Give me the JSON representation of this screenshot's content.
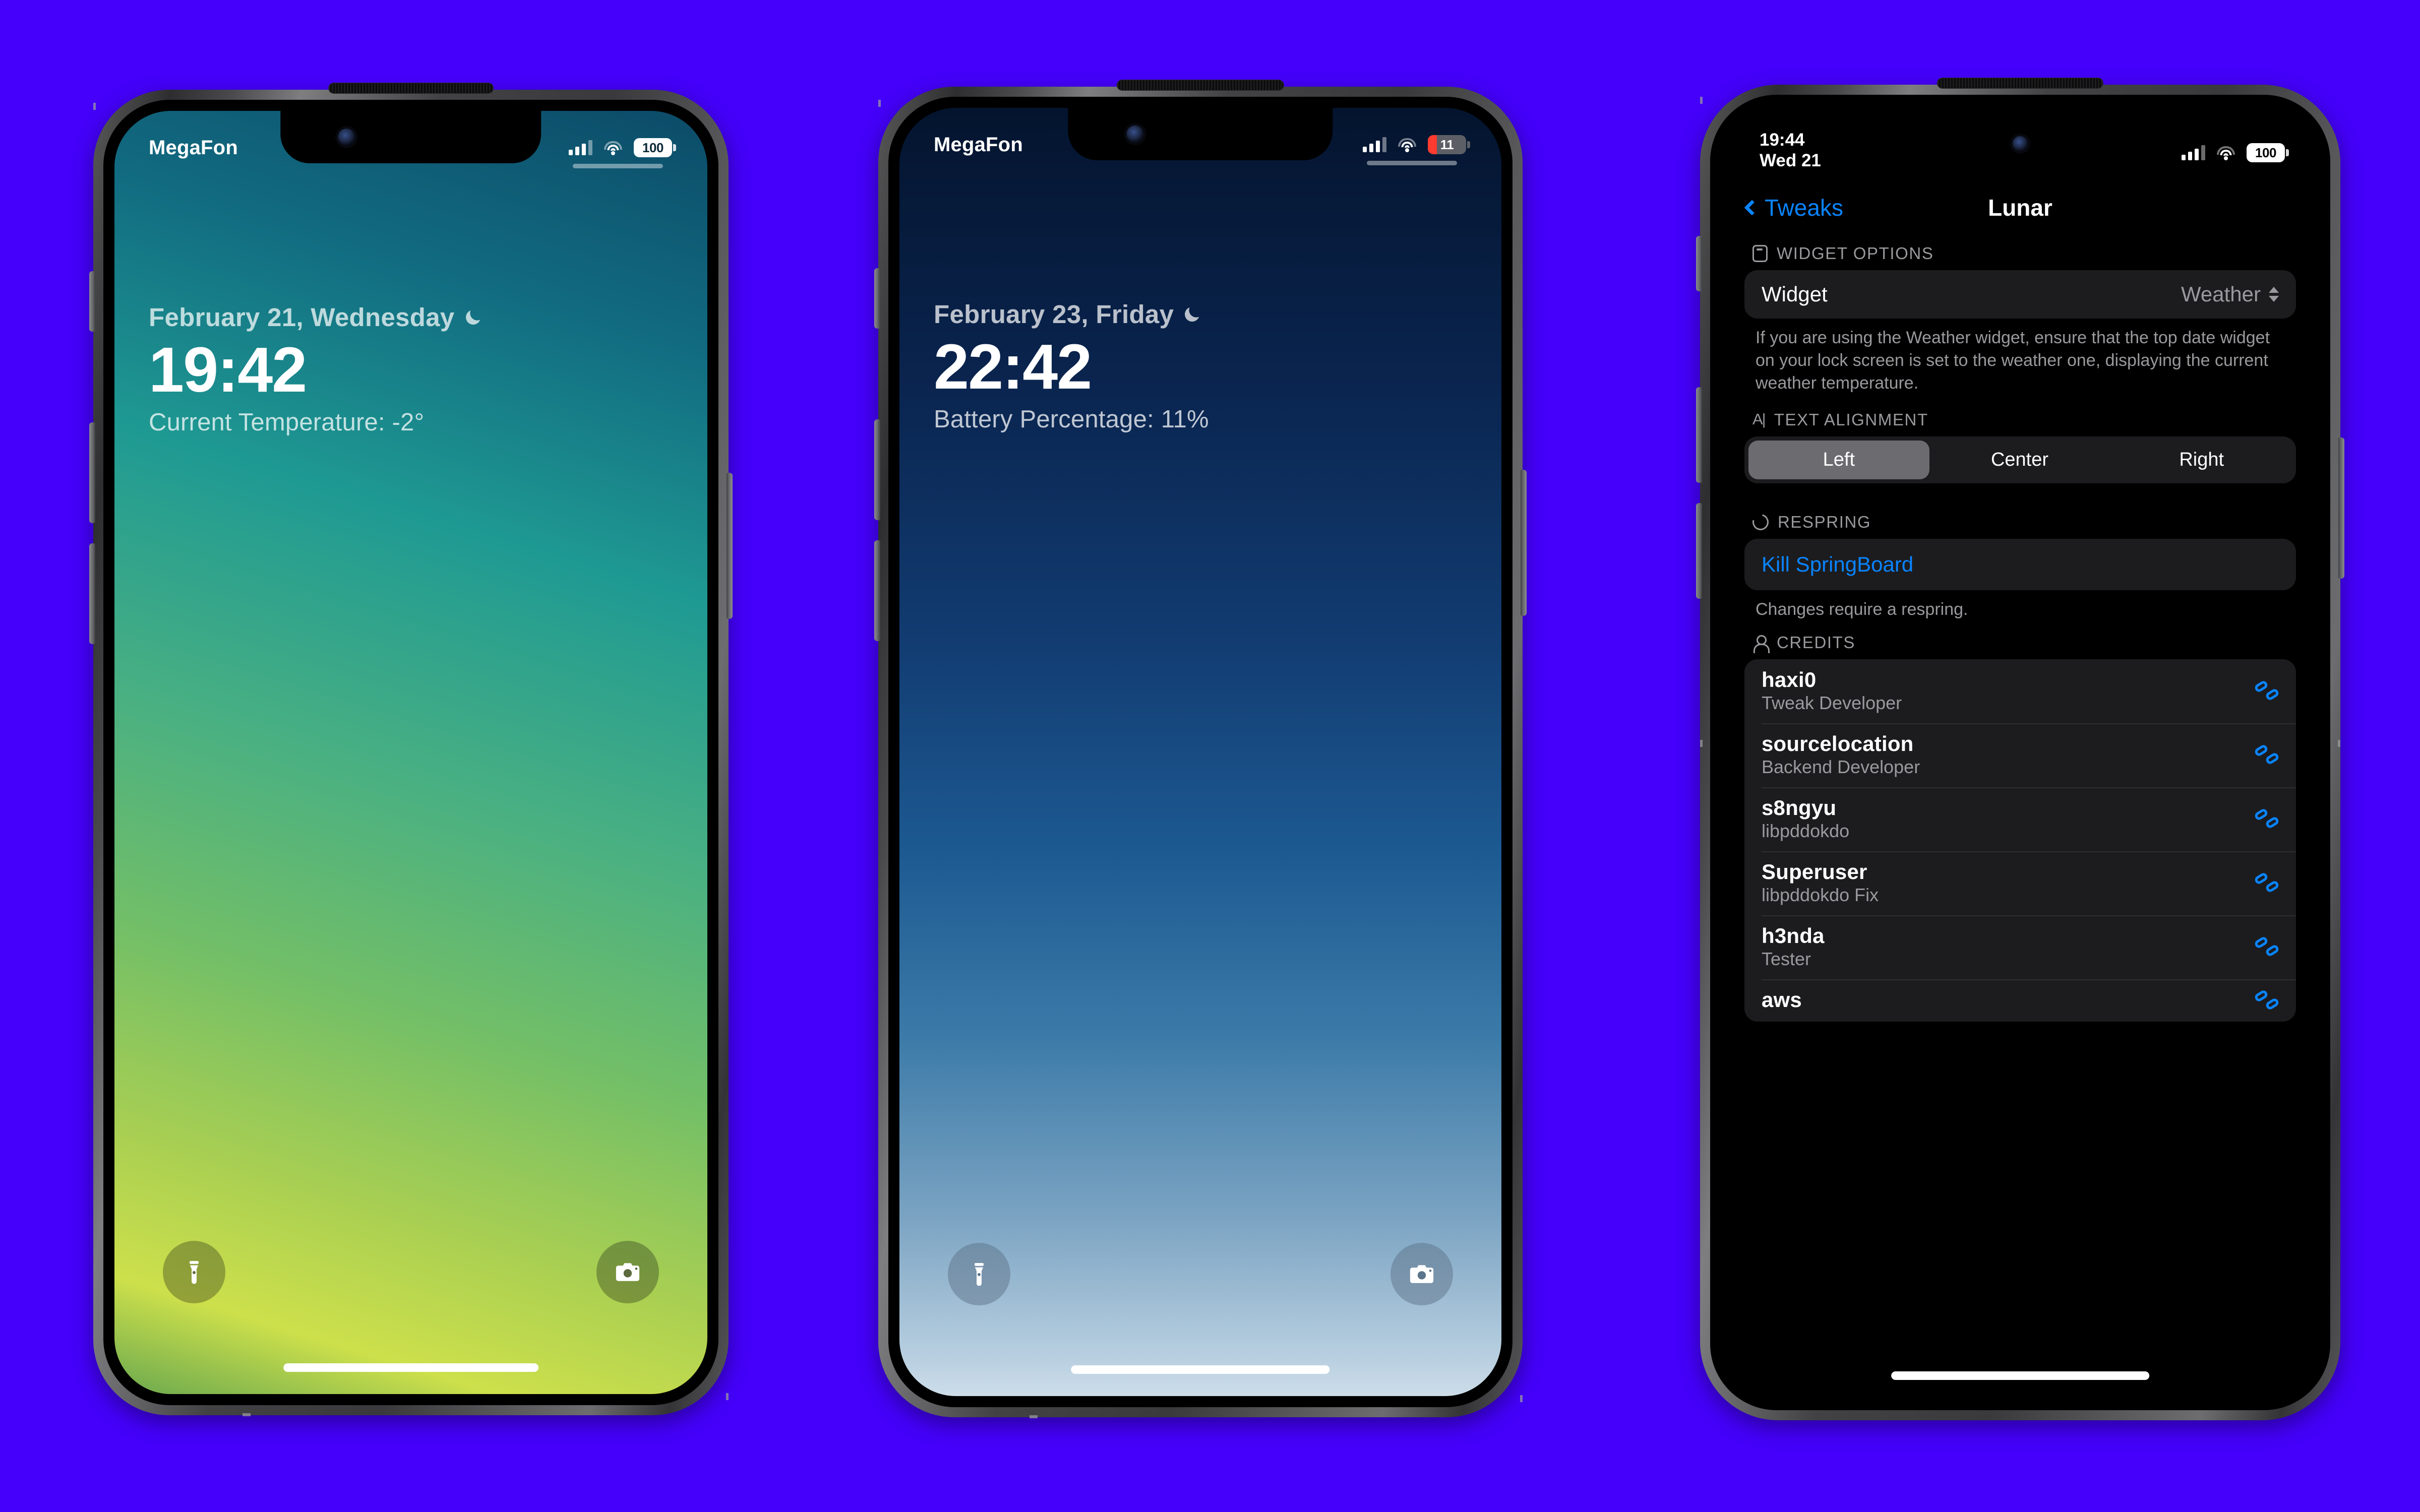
{
  "canvas": {
    "background_color": "#4400fa"
  },
  "phones": [
    {
      "id": "lockscreen-temperature",
      "statusbar": {
        "carrier": "MegaFon",
        "battery_percent": "100",
        "wifi_icon": "wifi-icon",
        "signal_icon": "cellular-signal-icon"
      },
      "lock": {
        "date": "February 21, Wednesday",
        "moon_icon": "crescent-moon-icon",
        "time": "19:42",
        "subtitle": "Current Temperature: -2°",
        "flashlight_icon": "flashlight-icon",
        "camera_icon": "camera-icon"
      },
      "wallpaper": {
        "from": "#0d4f6b",
        "mid": "#3fae8f",
        "to": "#cfe24a"
      }
    },
    {
      "id": "lockscreen-battery",
      "statusbar": {
        "carrier": "MegaFon",
        "battery_percent": "11",
        "wifi_icon": "wifi-icon",
        "signal_icon": "cellular-signal-icon"
      },
      "lock": {
        "date": "February 23, Friday",
        "moon_icon": "crescent-moon-icon",
        "time": "22:42",
        "subtitle": "Battery Percentage: 11%",
        "flashlight_icon": "flashlight-icon",
        "camera_icon": "camera-icon"
      },
      "wallpaper": {
        "from": "#04142e",
        "mid": "#1a4f86",
        "to": "#a8c3da"
      }
    }
  ],
  "settings": {
    "statusbar": {
      "time": "19:44",
      "date": "Wed 21",
      "battery_percent": "100"
    },
    "nav": {
      "back_label": "Tweaks",
      "title": "Lunar",
      "back_icon": "chevron-left-icon"
    },
    "widget_options": {
      "header": "WIDGET OPTIONS",
      "header_icon": "phone-icon",
      "row_label": "Widget",
      "row_value": "Weather",
      "row_value_icon": "up-down-chevron-icon",
      "footnote": "If you are using the Weather widget, ensure that the top date widget on your lock screen is set to the weather one, displaying the current weather temperature."
    },
    "text_alignment": {
      "header": "TEXT ALIGNMENT",
      "header_icon": "text-cursor-icon",
      "options": [
        "Left",
        "Center",
        "Right"
      ],
      "selected": "Left"
    },
    "respring": {
      "header": "RESPRING",
      "header_icon": "refresh-icon",
      "action_label": "Kill SpringBoard",
      "footnote": "Changes require a respring."
    },
    "credits": {
      "header": "CREDITS",
      "header_icon": "person-icon",
      "entries": [
        {
          "name": "haxi0",
          "role": "Tweak Developer",
          "link_icon": "link-icon"
        },
        {
          "name": "sourcelocation",
          "role": "Backend Developer",
          "link_icon": "link-icon"
        },
        {
          "name": "s8ngyu",
          "role": "libpddokdo",
          "link_icon": "link-icon"
        },
        {
          "name": "Superuser",
          "role": "libpddokdo Fix",
          "link_icon": "link-icon"
        },
        {
          "name": "h3nda",
          "role": "Tester",
          "link_icon": "link-icon"
        },
        {
          "name": "aws",
          "role": "",
          "link_icon": "link-icon"
        }
      ]
    },
    "colors": {
      "accent": "#0a84ff",
      "card": "#1c1c1e",
      "secondary_text": "#9a9a9e"
    }
  }
}
